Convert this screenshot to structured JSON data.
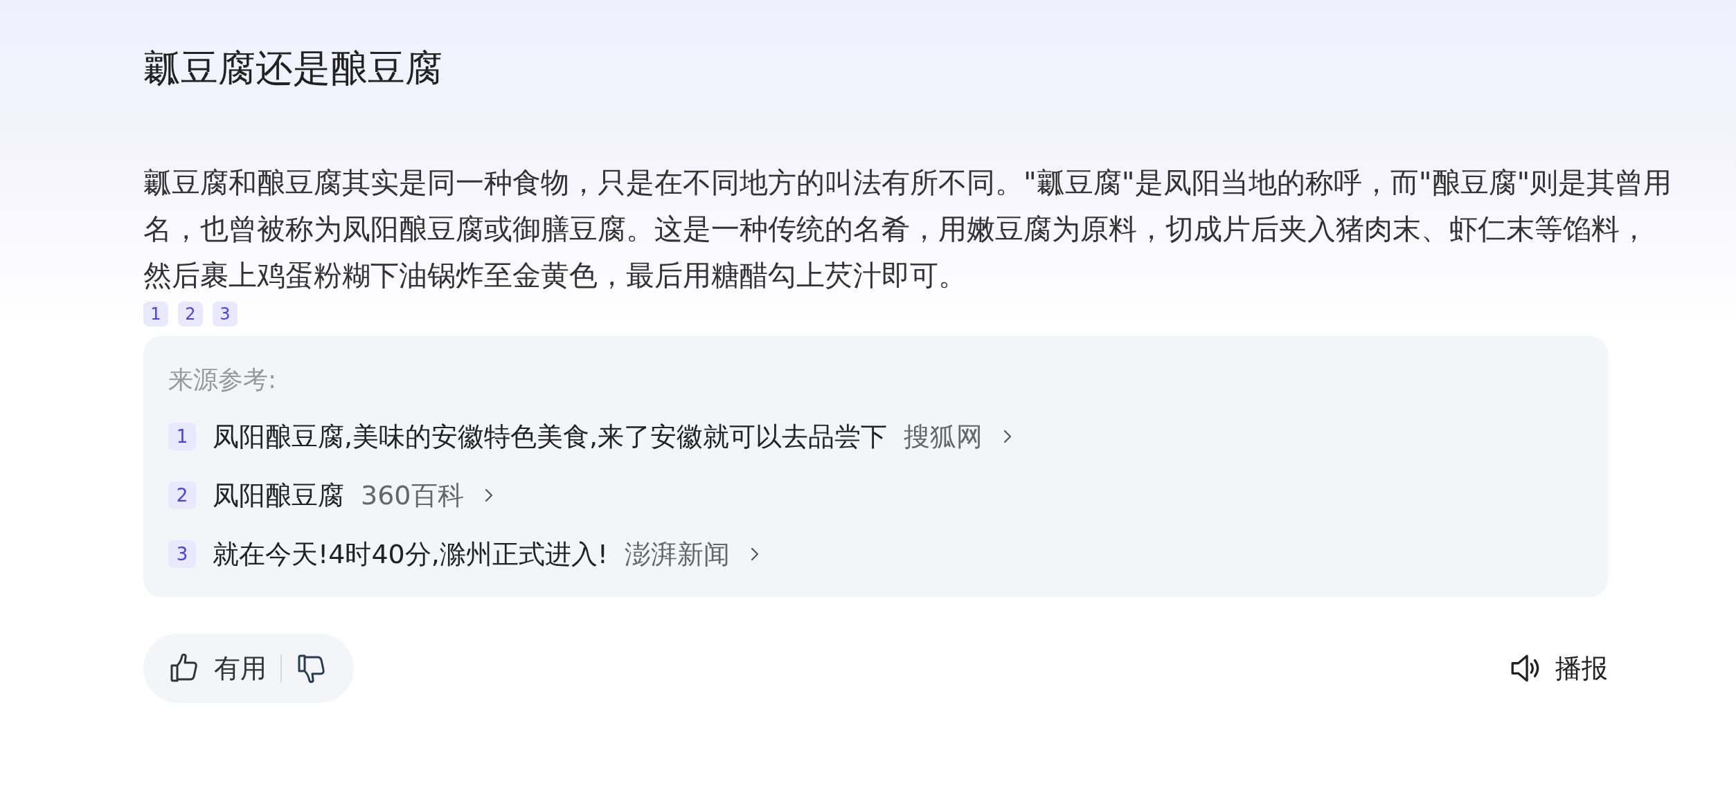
{
  "title": "瓤豆腐还是酿豆腐",
  "answer": {
    "text": "瓤豆腐和酿豆腐其实是同一种食物，只是在不同地方的叫法有所不同。\"瓤豆腐\"是凤阳当地的称呼，而\"酿豆腐\"则是其曾用名，也曾被称为凤阳酿豆腐或御膳豆腐。这是一种传统的名肴，用嫩豆腐为原料，切成片后夹入猪肉末、虾仁末等馅料，然后裹上鸡蛋粉糊下油锅炸至金黄色，最后用糖醋勾上芡汁即可。",
    "citations": [
      "1",
      "2",
      "3"
    ]
  },
  "sources": {
    "label": "来源参考:",
    "items": [
      {
        "index": "1",
        "title": "凤阳酿豆腐,美味的安徽特色美食,来了安徽就可以去品尝下",
        "site": "搜狐网"
      },
      {
        "index": "2",
        "title": "凤阳酿豆腐",
        "site": "360百科"
      },
      {
        "index": "3",
        "title": "就在今天!4时40分,滁州正式进入!",
        "site": "澎湃新闻"
      }
    ]
  },
  "feedback": {
    "like_label": "有用"
  },
  "speak": {
    "label": "播报"
  }
}
